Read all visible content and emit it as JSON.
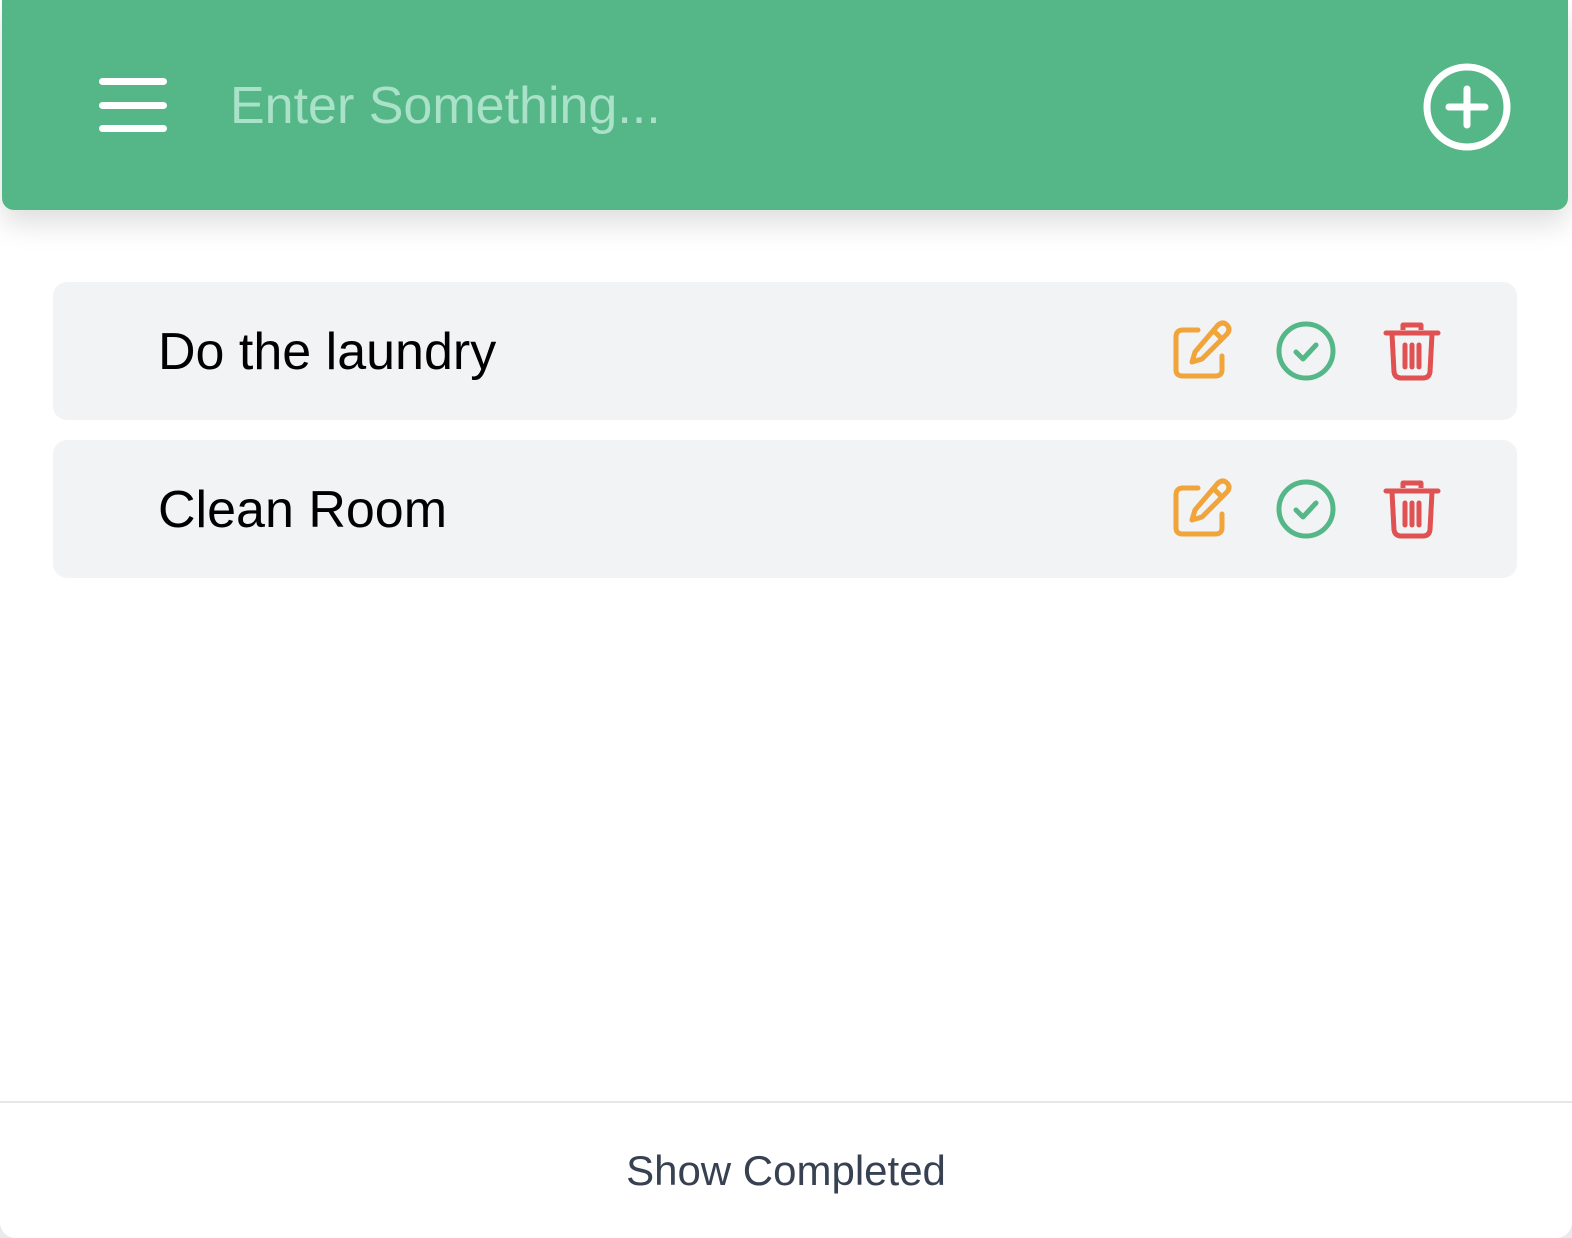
{
  "header": {
    "menu_icon": "hamburger-menu-icon",
    "input_placeholder": "Enter Something...",
    "input_value": "",
    "add_icon": "plus-circle-icon",
    "background_color": "#55b787"
  },
  "todos": [
    {
      "text": "Do the laundry",
      "actions": [
        "edit-icon",
        "check-circle-icon",
        "trash-icon"
      ]
    },
    {
      "text": "Clean Room",
      "actions": [
        "edit-icon",
        "check-circle-icon",
        "trash-icon"
      ]
    }
  ],
  "colors": {
    "edit": "#f0a43a",
    "done": "#55b787",
    "delete": "#e05252",
    "item_background": "#f2f3f5"
  },
  "footer": {
    "toggle_label": "Show Completed"
  }
}
